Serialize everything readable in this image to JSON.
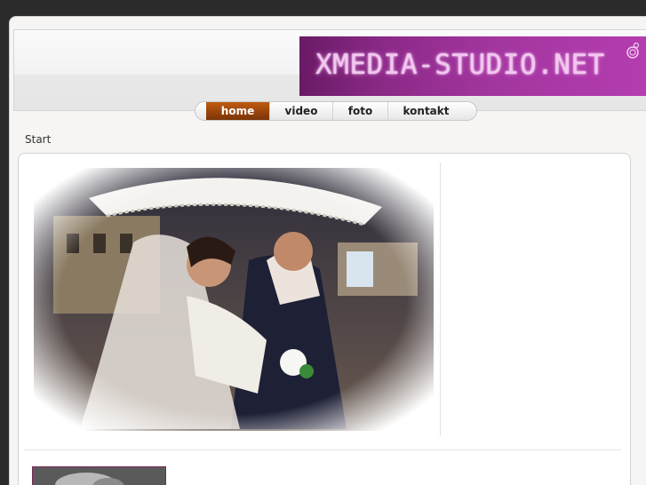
{
  "site": {
    "banner_text": "XMEDIA-STUDIO.NET",
    "brand_color": "#a2359e"
  },
  "nav": {
    "items": [
      "home",
      "video",
      "foto",
      "kontakt"
    ],
    "active": "home"
  },
  "breadcrumb": {
    "label": "Start"
  },
  "main": {
    "hero_image": "wedding-couple-kiss-under-lace-umbrella",
    "thumbnail_image": "black-and-white-photo-thumbnail"
  }
}
